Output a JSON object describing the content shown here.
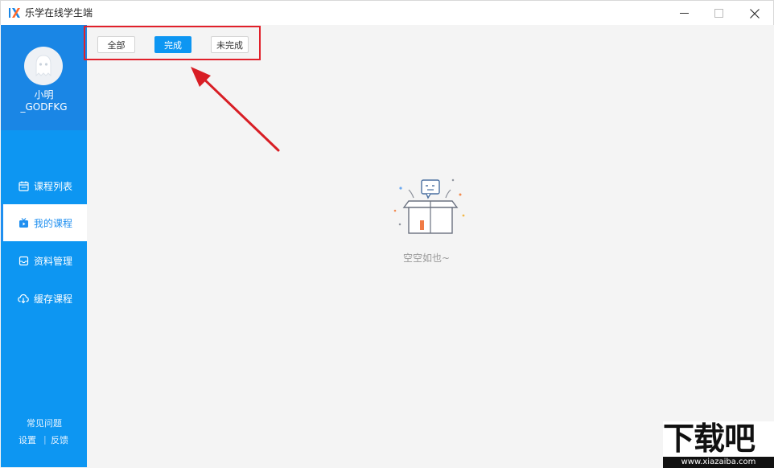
{
  "app": {
    "title": "乐学在线学生端",
    "logo_icon": "lx-logo-icon"
  },
  "window_controls": {
    "minimize_icon": "minimize-icon",
    "maximize_icon": "maximize-icon",
    "close_icon": "close-icon"
  },
  "sidebar": {
    "user": {
      "name": "小明\n_GODFKG",
      "avatar_icon": "ghost-avatar-icon"
    },
    "items": [
      {
        "label": "课程列表",
        "icon": "calendar-icon",
        "active": false
      },
      {
        "label": "我的课程",
        "icon": "tv-icon",
        "active": true
      },
      {
        "label": "资料管理",
        "icon": "inbox-icon",
        "active": false
      },
      {
        "label": "缓存课程",
        "icon": "cloud-download-icon",
        "active": false
      }
    ],
    "footer": {
      "faq": "常见问题",
      "settings": "设置",
      "separator": "|",
      "feedback": "反馈"
    }
  },
  "filters": {
    "all": "全部",
    "done": "完成",
    "undone": "未完成",
    "selected": "done"
  },
  "empty_state": {
    "message": "空空如也~",
    "icon": "empty-box-icon"
  },
  "watermark": {
    "text": "下载吧",
    "url": "www.xiazaiba.com"
  },
  "colors": {
    "primary": "#0d96f2",
    "profile_bg": "#1a86e5",
    "highlight": "#e1202a"
  }
}
